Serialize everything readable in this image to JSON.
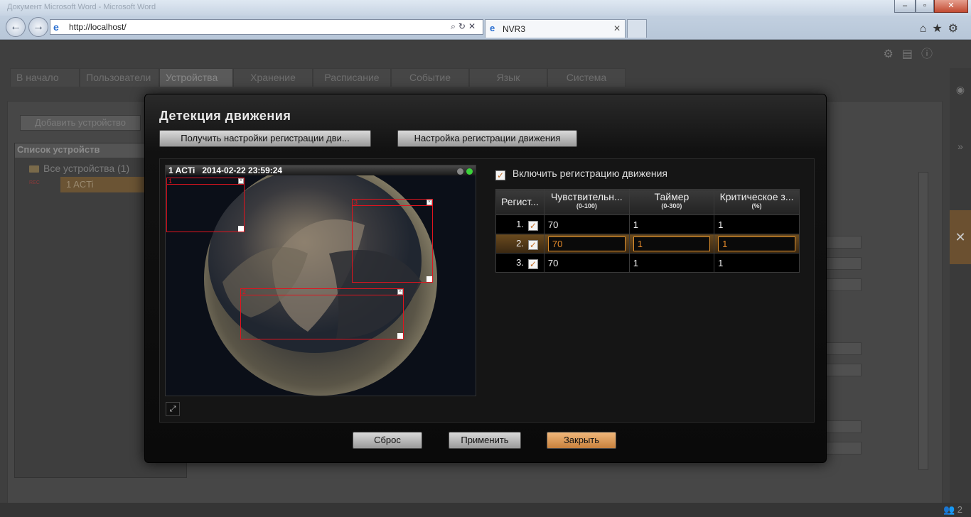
{
  "browser": {
    "url": "http://localhost/",
    "tab_title": "NVR3",
    "ghost_title": "Документ Microsoft Word - Microsoft Word"
  },
  "app": {
    "tabs": [
      "В начало",
      "Пользователи",
      "Устройства",
      "Хранение",
      "Расписание",
      "Событие",
      "Язык",
      "Система"
    ],
    "add_device": "Добавить устройство",
    "device_list_title": "Список устройств",
    "all_devices": "Все устройства (1)",
    "device_name": "1 ACTi",
    "rec_badge": "REC",
    "user_count": "2"
  },
  "modal": {
    "title": "Детекция движения",
    "btn_get": "Получить настройки регистрации дви...",
    "btn_setup": "Настройка регистрации движения",
    "video_label": "1 ACTi   2014-02-22 23:59:24",
    "regions": [
      {
        "label": "1"
      },
      {
        "label": "3"
      },
      {
        "label": "2"
      }
    ],
    "enable_label": "Включить регистрацию движения",
    "headers": {
      "reg": "Регист...",
      "sens": "Чувствительн...",
      "sens_range": "(0-100)",
      "timer": "Таймер",
      "timer_range": "(0-300)",
      "crit": "Критическое з...",
      "crit_unit": "(%)"
    },
    "rows": [
      {
        "idx": "1.",
        "sens": "70",
        "timer": "1",
        "crit": "1"
      },
      {
        "idx": "2.",
        "sens": "70",
        "timer": "1",
        "crit": "1"
      },
      {
        "idx": "3.",
        "sens": "70",
        "timer": "1",
        "crit": "1"
      }
    ],
    "btn_reset": "Сброс",
    "btn_apply": "Применить",
    "btn_close": "Закрыть"
  },
  "colors": {
    "accent": "#e0902c",
    "region": "#e0141e"
  }
}
